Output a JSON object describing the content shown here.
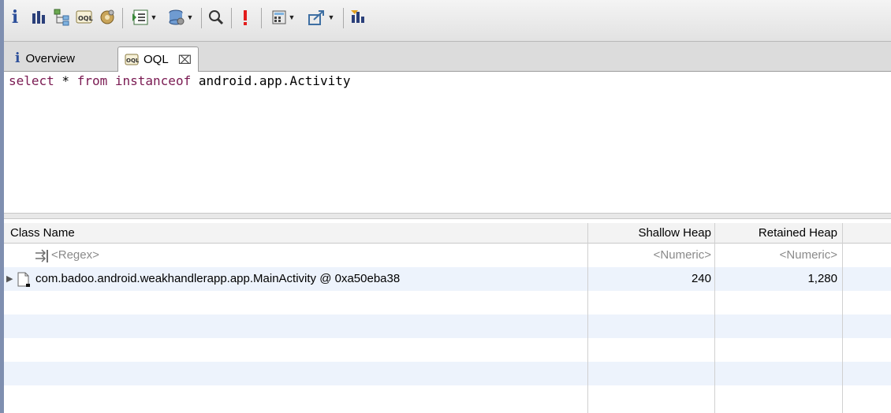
{
  "toolbar": {
    "icons": [
      "info-icon",
      "histogram-icon",
      "dominator-tree-icon",
      "oql-icon",
      "threads-icon",
      "query-browser-icon",
      "heap-dump-icon",
      "search-icon",
      "leak-suspects-icon",
      "calculator-icon",
      "export-icon",
      "run-query-icon"
    ]
  },
  "tabs": [
    {
      "label": "Overview",
      "icon": "info-icon"
    },
    {
      "label": "OQL",
      "icon": "oql-icon",
      "close": "⌧"
    }
  ],
  "query": {
    "kw1": "select",
    "rest1": " * ",
    "kw2": "from",
    "rest2": " ",
    "kw3": "instanceof",
    "rest3": " android.app.Activity"
  },
  "table": {
    "columns": [
      "Class Name",
      "Shallow Heap",
      "Retained Heap"
    ],
    "filter": {
      "name": "<Regex>",
      "shallow": "<Numeric>",
      "retained": "<Numeric>"
    },
    "rows": [
      {
        "name": "com.badoo.android.weakhandlerapp.app.MainActivity @ 0xa50eba38",
        "shallow": "240",
        "retained": "1,280"
      }
    ]
  }
}
